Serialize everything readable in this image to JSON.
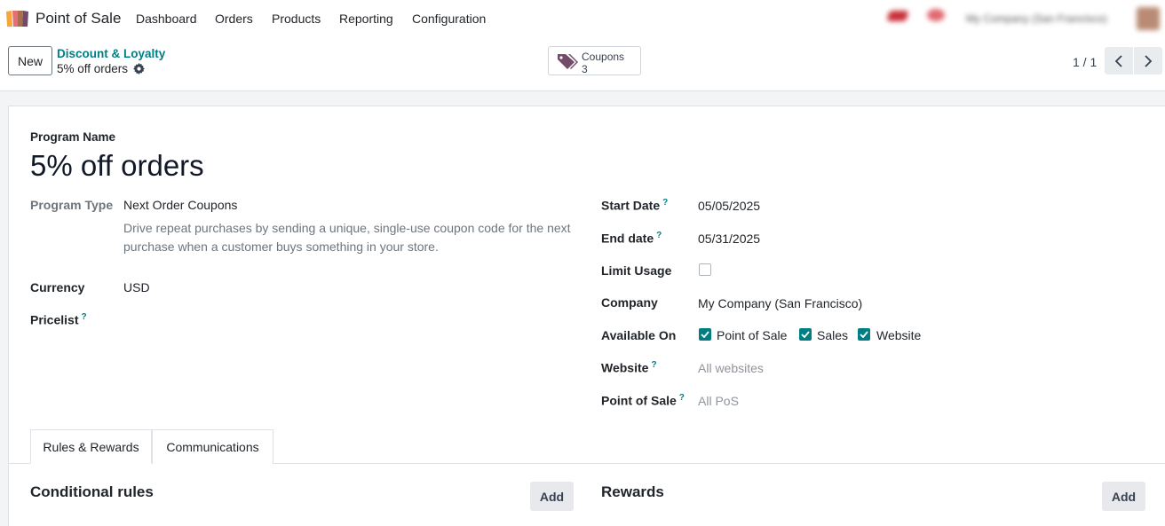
{
  "navbar": {
    "app_name": "Point of Sale",
    "menu": [
      "Dashboard",
      "Orders",
      "Products",
      "Reporting",
      "Configuration"
    ],
    "company_switcher": "My Company (San Francisco)"
  },
  "control_panel": {
    "new_label": "New",
    "breadcrumb_parent": "Discount & Loyalty",
    "breadcrumb_current": "5% off orders",
    "smart_button": {
      "label": "Coupons",
      "value": "3",
      "icon": "tags-icon"
    },
    "pager": "1 / 1"
  },
  "form": {
    "program_name_label": "Program Name",
    "program_name": "5% off orders",
    "left": {
      "program_type_label": "Program Type",
      "program_type": "Next Order Coupons",
      "program_type_help": "Drive repeat purchases by sending a unique, single-use coupon code for the next purchase when a customer buys something in your store.",
      "currency_label": "Currency",
      "currency": "USD",
      "pricelist_label": "Pricelist",
      "help_mark": "?"
    },
    "right": {
      "start_date_label": "Start Date",
      "start_date": "05/05/2025",
      "end_date_label": "End date",
      "end_date": "05/31/2025",
      "limit_usage_label": "Limit Usage",
      "company_label": "Company",
      "company": "My Company (San Francisco)",
      "available_on_label": "Available On",
      "available_on": [
        {
          "label": "Point of Sale",
          "checked": true
        },
        {
          "label": "Sales",
          "checked": true
        },
        {
          "label": "Website",
          "checked": true
        }
      ],
      "website_label": "Website",
      "website_placeholder": "All websites",
      "pos_label": "Point of Sale",
      "pos_placeholder": "All PoS",
      "help_mark": "?"
    }
  },
  "tabs": [
    "Rules & Rewards",
    "Communications"
  ],
  "sections": {
    "rules_title": "Conditional rules",
    "rewards_title": "Rewards",
    "add_label": "Add"
  },
  "colors": {
    "accent": "#017e84",
    "logo_orange": "#f8a53a",
    "logo_red": "#e46f78",
    "logo_purple": "#714b67"
  }
}
